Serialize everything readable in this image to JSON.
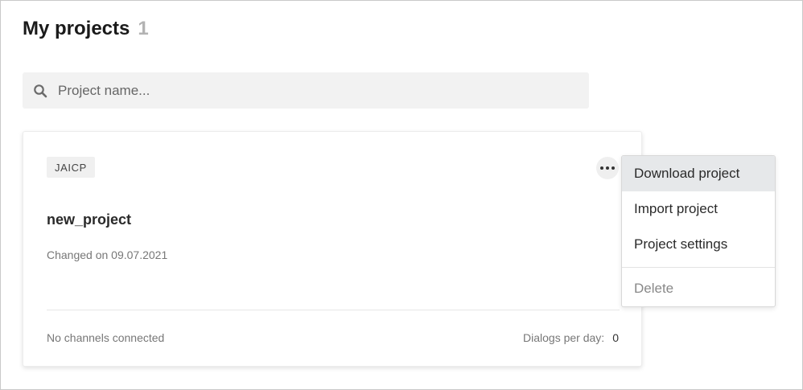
{
  "header": {
    "title": "My projects",
    "count": "1"
  },
  "search": {
    "placeholder": "Project name...",
    "icon": "search-icon"
  },
  "project_card": {
    "tag": "JAICP",
    "name": "new_project",
    "changed": "Changed on 09.07.2021",
    "channels": "No channels connected",
    "dialogs_label": "Dialogs per day:",
    "dialogs_value": "0",
    "more_icon": "more-horizontal-icon"
  },
  "context_menu": {
    "items": [
      {
        "label": "Download project",
        "active": true
      },
      {
        "label": "Import project"
      },
      {
        "label": "Project settings"
      },
      {
        "label": "Delete"
      }
    ]
  },
  "colors": {
    "accent_bg": "#f2f2f2",
    "menu_active": "#e6e8ea"
  }
}
